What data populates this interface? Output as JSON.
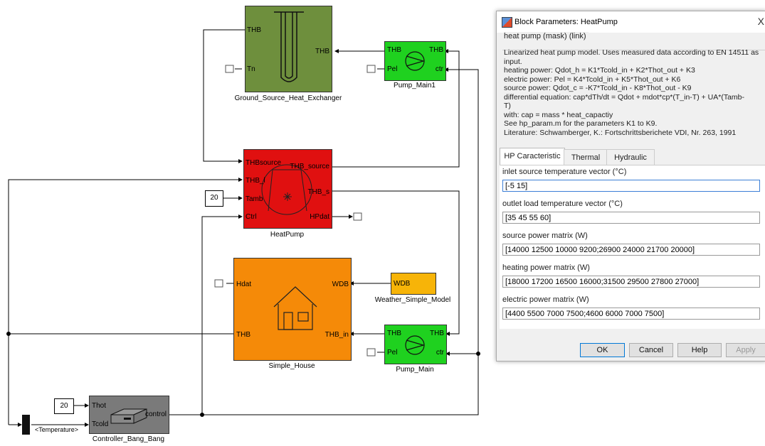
{
  "diagram": {
    "blocks": {
      "ground_heat_exchanger": {
        "name": "Ground_Source_Heat_Exchanger",
        "port_thb_left": "THB",
        "port_thb_right": "THB",
        "port_tn": "Tn"
      },
      "pump_main1": {
        "name": "Pump_Main1",
        "port_thb_in": "THB",
        "port_thb_out": "THB",
        "port_pel": "Pel",
        "port_ctr": "ctr"
      },
      "heatpump": {
        "name": "HeatPump",
        "port_thb_source_in": "THBsource",
        "port_thb_source_out": "THB_source",
        "port_thb_in": "THB_l",
        "port_thb_s": "THB_s",
        "port_tamb": "Tamb",
        "port_ctrl": "Ctrl",
        "port_hpdat": "HPdat"
      },
      "simple_house": {
        "name": "Simple_House",
        "port_hdat": "Hdat",
        "port_wdb": "WDB",
        "port_thb": "THB",
        "port_thb_in": "THB_in"
      },
      "weather": {
        "name": "Weather_Simple_Model",
        "port_wdb": "WDB"
      },
      "pump_main": {
        "name": "Pump_Main",
        "port_thb_in": "THB",
        "port_thb_out": "THB",
        "port_pel": "Pel",
        "port_ctr": "ctr"
      },
      "controller": {
        "name": "Controller_Bang_Bang",
        "port_thot": "Thot",
        "port_tcold": "Tcold",
        "port_control": "control"
      }
    },
    "constants": {
      "tamb_const": "20",
      "thot_const": "20"
    },
    "bus_selector_label": "<Temperature>"
  },
  "dialog": {
    "title": "Block Parameters: HeatPump",
    "close_label": "X",
    "group_title": "heat pump (mask) (link)",
    "description_lines": [
      "Linearized heat pump model. Uses measured data according to EN 14511 as",
      "input.",
      "heating power: Qdot_h = K1*Tcold_in + K2*Thot_out + K3",
      "electric power: Pel = K4*Tcold_in + K5*Thot_out + K6",
      "source power: Qdot_c = -K7*Tcold_in - K8*Thot_out - K9",
      "differential equation: cap*dTh/dt = Qdot + mdot*cp*(T_in-T) + UA*(Tamb-",
      "T)",
      "with: cap = mass * heat_capactiy",
      "See hp_param.m for the parameters K1 to K9.",
      "Literature: Schwamberger, K.: Fortschrittsberichete VDI, Nr. 263, 1991"
    ],
    "tabs": [
      "HP Caracteristic",
      "Thermal",
      "Hydraulic"
    ],
    "params": [
      {
        "label": "inlet source temperature vector (°C)",
        "value": "[-5 15]"
      },
      {
        "label": "outlet load temperature vector (°C)",
        "value": "[35 45 55 60]"
      },
      {
        "label": "source power matrix (W)",
        "value": "[14000 12500 10000 9200;26900 24000 21700 20000]"
      },
      {
        "label": "heating power matrix (W)",
        "value": "[18000 17200 16500 16000;31500 29500 27800 27000]"
      },
      {
        "label": "electric power matrix (W)",
        "value": "[4400 5500 7000 7500;4600 6000 7000 7500]"
      }
    ],
    "buttons": {
      "ok": "OK",
      "cancel": "Cancel",
      "help": "Help",
      "apply": "Apply"
    }
  },
  "colors": {
    "ground_exchanger": "#6e8f3d",
    "pump": "#1fd11f",
    "heatpump": "#e01010",
    "house": "#f58a08",
    "weather": "#f7b408",
    "controller": "#7a7a7a"
  }
}
